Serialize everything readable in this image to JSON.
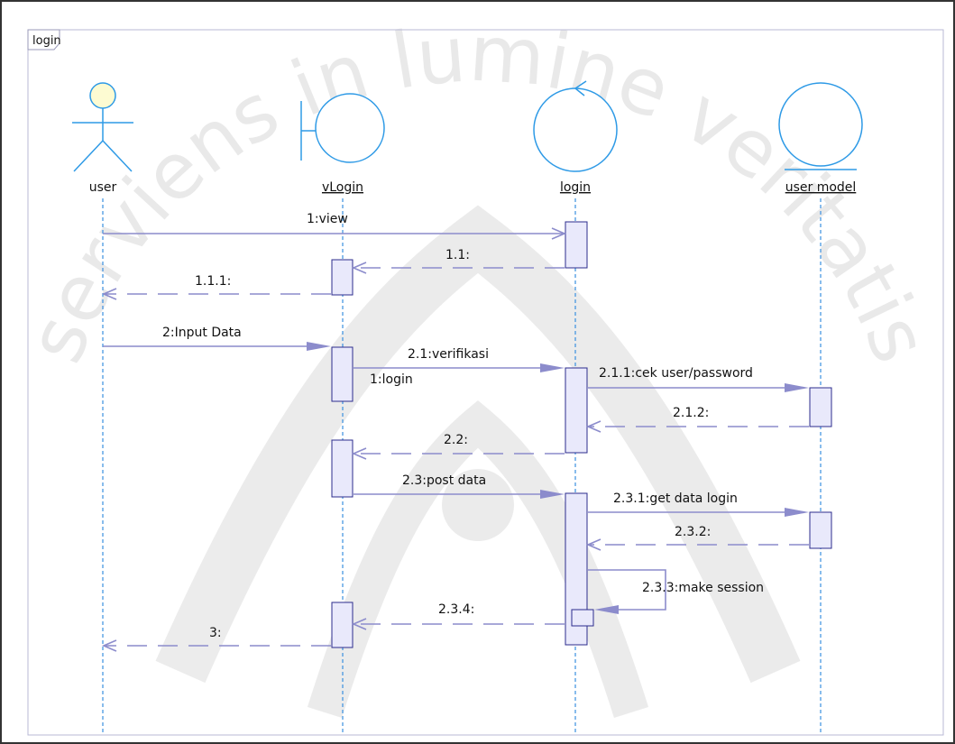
{
  "frame": {
    "label": "login"
  },
  "watermark": {
    "text": "serviens in lumine veritatis"
  },
  "lifelines": [
    {
      "id": "user",
      "name": "user",
      "kind": "actor"
    },
    {
      "id": "vlogin",
      "name": "vLogin",
      "kind": "boundary"
    },
    {
      "id": "login",
      "name": "login",
      "kind": "control"
    },
    {
      "id": "usermodel",
      "name": "user model",
      "kind": "entity"
    }
  ],
  "messages": [
    {
      "id": "m1",
      "label": "1:view",
      "from": "user",
      "to": "login",
      "type": "sync"
    },
    {
      "id": "m1_1",
      "label": "1.1:",
      "from": "login",
      "to": "vlogin",
      "type": "return"
    },
    {
      "id": "m1_1_1",
      "label": "1.1.1:",
      "from": "vlogin",
      "to": "user",
      "type": "return"
    },
    {
      "id": "m2",
      "label": "2:Input Data",
      "from": "user",
      "to": "vlogin",
      "type": "sync"
    },
    {
      "id": "m2_1",
      "label": "2.1:verifikasi",
      "from": "vlogin",
      "to": "login",
      "type": "sync"
    },
    {
      "id": "m2_1_1",
      "label": "2.1.1:cek user/password",
      "from": "login",
      "to": "usermodel",
      "type": "sync"
    },
    {
      "id": "m2_1_2",
      "label": "2.1.2:",
      "from": "usermodel",
      "to": "login",
      "type": "return"
    },
    {
      "id": "m2_2",
      "label": "2.2:",
      "from": "login",
      "to": "vlogin",
      "type": "return"
    },
    {
      "id": "m2_3",
      "label": "2.3:post data",
      "from": "vlogin",
      "to": "login",
      "type": "sync"
    },
    {
      "id": "m2_3_1",
      "label": "2.3.1:get data login",
      "from": "login",
      "to": "usermodel",
      "type": "sync"
    },
    {
      "id": "m2_3_2",
      "label": "2.3.2:",
      "from": "usermodel",
      "to": "login",
      "type": "return"
    },
    {
      "id": "m2_3_3",
      "label": "2.3.3:make session",
      "from": "login",
      "to": "login",
      "type": "self"
    },
    {
      "id": "m2_3_4",
      "label": "2.3.4:",
      "from": "login",
      "to": "vlogin",
      "type": "return"
    },
    {
      "id": "m3",
      "label": "3:",
      "from": "vlogin",
      "to": "user",
      "type": "return"
    }
  ],
  "notes": [
    {
      "id": "n1",
      "label": "1:login"
    }
  ],
  "colors": {
    "outline": "#3b5fc4",
    "lifeline": "#3a8fe0",
    "activation": "#e9e9fb",
    "activation_border": "#2c2c8c",
    "message": "#8c8ccc",
    "message_text": "#111111",
    "actor_head": "#fdfbd2",
    "icon_stroke": "#2e9ae6",
    "frame_border": "#b9b9d6"
  }
}
